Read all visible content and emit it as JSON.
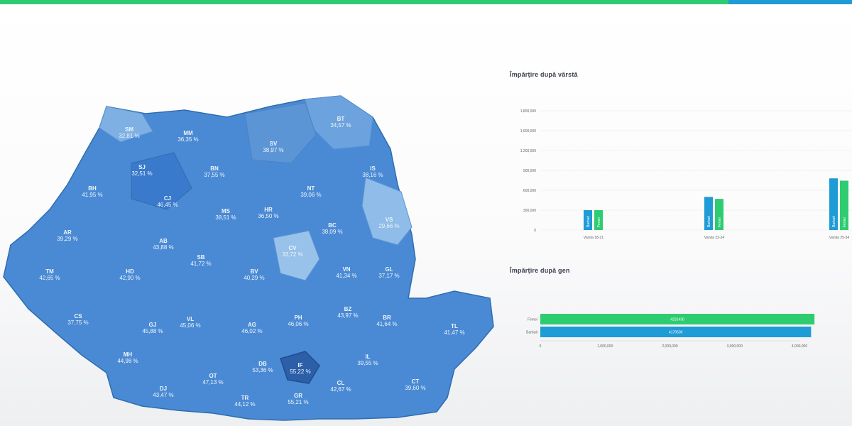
{
  "progress": {
    "fraction": 0.855,
    "fill_color": "#2ecc71",
    "rest_color": "#1f9bd6"
  },
  "map": {
    "counties": [
      {
        "code": "SM",
        "value": "32,81 %"
      },
      {
        "code": "MM",
        "value": "36,35 %"
      },
      {
        "code": "SV",
        "value": "38,97 %"
      },
      {
        "code": "BT",
        "value": "34,57 %"
      },
      {
        "code": "SJ",
        "value": "32,51 %"
      },
      {
        "code": "BN",
        "value": "37,55 %"
      },
      {
        "code": "IS",
        "value": "38,16 %"
      },
      {
        "code": "BH",
        "value": "41,95 %"
      },
      {
        "code": "CJ",
        "value": "46,45 %"
      },
      {
        "code": "NT",
        "value": "39,06 %"
      },
      {
        "code": "MS",
        "value": "38,51 %"
      },
      {
        "code": "HR",
        "value": "36,50 %"
      },
      {
        "code": "BC",
        "value": "38,09 %"
      },
      {
        "code": "VS",
        "value": "29,66 %"
      },
      {
        "code": "AR",
        "value": "39,29 %"
      },
      {
        "code": "AB",
        "value": "43,88 %"
      },
      {
        "code": "CV",
        "value": "33,72 %"
      },
      {
        "code": "SB",
        "value": "41,72 %"
      },
      {
        "code": "BV",
        "value": "40,29 %"
      },
      {
        "code": "TM",
        "value": "42,65 %"
      },
      {
        "code": "HD",
        "value": "42,90 %"
      },
      {
        "code": "VN",
        "value": "41,34 %"
      },
      {
        "code": "GL",
        "value": "37,17 %"
      },
      {
        "code": "CS",
        "value": "37,75 %"
      },
      {
        "code": "GJ",
        "value": "45,88 %"
      },
      {
        "code": "VL",
        "value": "45,06 %"
      },
      {
        "code": "AG",
        "value": "46,02 %"
      },
      {
        "code": "PH",
        "value": "46,06 %"
      },
      {
        "code": "BZ",
        "value": "43,97 %"
      },
      {
        "code": "BR",
        "value": "41,64 %"
      },
      {
        "code": "TL",
        "value": "41,47 %"
      },
      {
        "code": "MH",
        "value": "44,98 %"
      },
      {
        "code": "DB",
        "value": "53,36 %"
      },
      {
        "code": "IF",
        "value": "55,22 %"
      },
      {
        "code": "IL",
        "value": "39,55 %"
      },
      {
        "code": "DJ",
        "value": "43,47 %"
      },
      {
        "code": "OT",
        "value": "47,13 %"
      },
      {
        "code": "TR",
        "value": "44,12 %"
      },
      {
        "code": "GR",
        "value": "55,21 %"
      },
      {
        "code": "CL",
        "value": "42,67 %"
      },
      {
        "code": "CT",
        "value": "39,60 %"
      }
    ]
  },
  "age_chart": {
    "title": "Împărțire după vârstă",
    "chart_data": {
      "type": "bar",
      "categories": [
        "Varsta 18-21",
        "Varsta 22-24",
        "Varsta 25-34"
      ],
      "ylim": [
        0,
        1800000
      ],
      "yticks": [
        "1,800,000",
        "1,600,000",
        "1,200,000",
        "900,000",
        "600,000",
        "300,000",
        "0"
      ],
      "series": [
        {
          "name": "Barbati",
          "color": "#1f9bd6",
          "values": [
            300000,
            500000,
            780000
          ],
          "labels": [
            "Barbati",
            "Barbati",
            "Barbati"
          ]
        },
        {
          "name": "Femei",
          "color": "#2ecc71",
          "values": [
            300000,
            470000,
            745000
          ],
          "labels": [
            "Femei",
            "Femei",
            "Femei"
          ]
        }
      ]
    }
  },
  "gender_chart": {
    "title": "Împărțire după gen",
    "chart_data": {
      "type": "bar",
      "orientation": "horizontal",
      "categories": [
        "Femei",
        "Barbati"
      ],
      "values": [
        4231430,
        4179500
      ],
      "value_labels": [
        "4231430",
        "4179500"
      ],
      "colors": [
        "#2ecc71",
        "#1f9bd6"
      ],
      "xlim": [
        0,
        4000000
      ],
      "xticks": [
        "0",
        "1,000,000",
        "2,000,000",
        "3,000,000",
        "4,000,000"
      ]
    }
  }
}
